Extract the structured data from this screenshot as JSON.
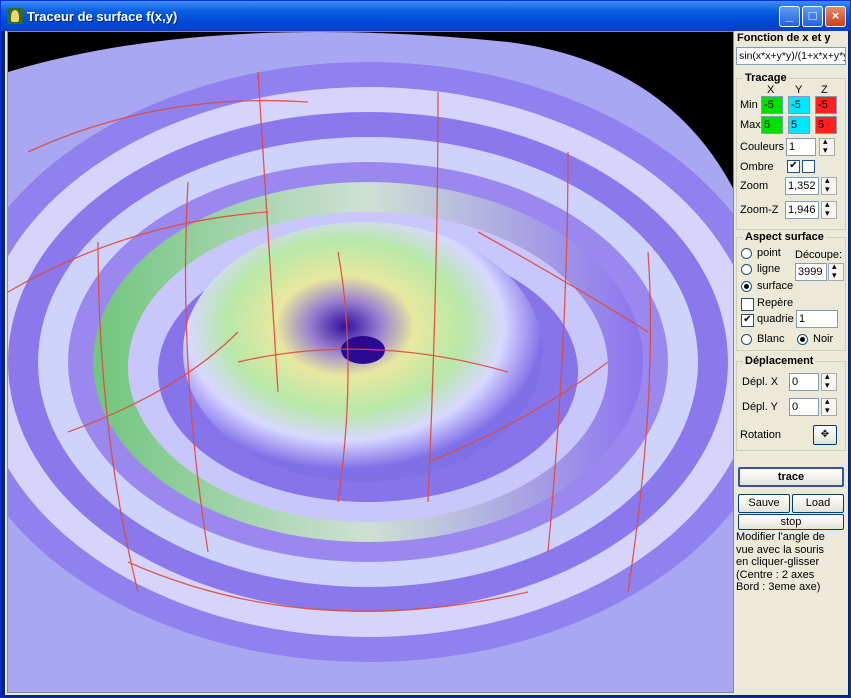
{
  "window": {
    "title": "Traceur de surface f(x,y)"
  },
  "titlebar": {
    "min": "_",
    "max": "□",
    "close": "×"
  },
  "function": {
    "heading": "Fonction de x et y",
    "expression": "sin(x*x+y*y)/(1+x*x+y*y)"
  },
  "tracage": {
    "title": "Tracage",
    "col_x": "X",
    "col_y": "Y",
    "col_z": "Z",
    "min_label": "Min",
    "max_label": "Max",
    "min_x": "-5",
    "min_y": "-5",
    "min_z": "-5",
    "max_x": "5",
    "max_y": "5",
    "max_z": "5",
    "couleurs_label": "Couleurs",
    "couleurs_value": "1",
    "ombre_label": "Ombre",
    "ombre_checked": "✔",
    "ombre_checked2": "",
    "zoom_label": "Zoom",
    "zoom_value": "1,352",
    "zoomz_label": "Zoom-Z",
    "zoomz_value": "1,946",
    "colors": {
      "x": "#00e000",
      "y": "#00e8ff",
      "z": "#ff2020"
    }
  },
  "aspect": {
    "title": "Aspect surface",
    "point_label": "point",
    "ligne_label": "ligne",
    "surface_label": "surface",
    "decoupe_label": "Découpe:",
    "decoupe_value": "3999",
    "repere_label": "Repère",
    "quadrie_label": "quadrie",
    "quadrie_value": "1",
    "quadrie_check": "✔",
    "blanc_label": "Blanc",
    "noir_label": "Noir"
  },
  "deplacement": {
    "title": "Déplacement",
    "deplx_label": "Dépl. X",
    "deplx_value": "0",
    "deply_label": "Dépl. Y",
    "deply_value": "0",
    "rotation_label": "Rotation"
  },
  "buttons": {
    "trace": "trace",
    "sauve": "Sauve",
    "load": "Load",
    "stop": "stop"
  },
  "help": {
    "line1": "Modifier l'angle de",
    "line2": "vue avec la souris",
    "line3": "en cliquer-glisser",
    "line4": "(Centre : 2 axes",
    "line5": "Bord : 3eme axe)"
  }
}
